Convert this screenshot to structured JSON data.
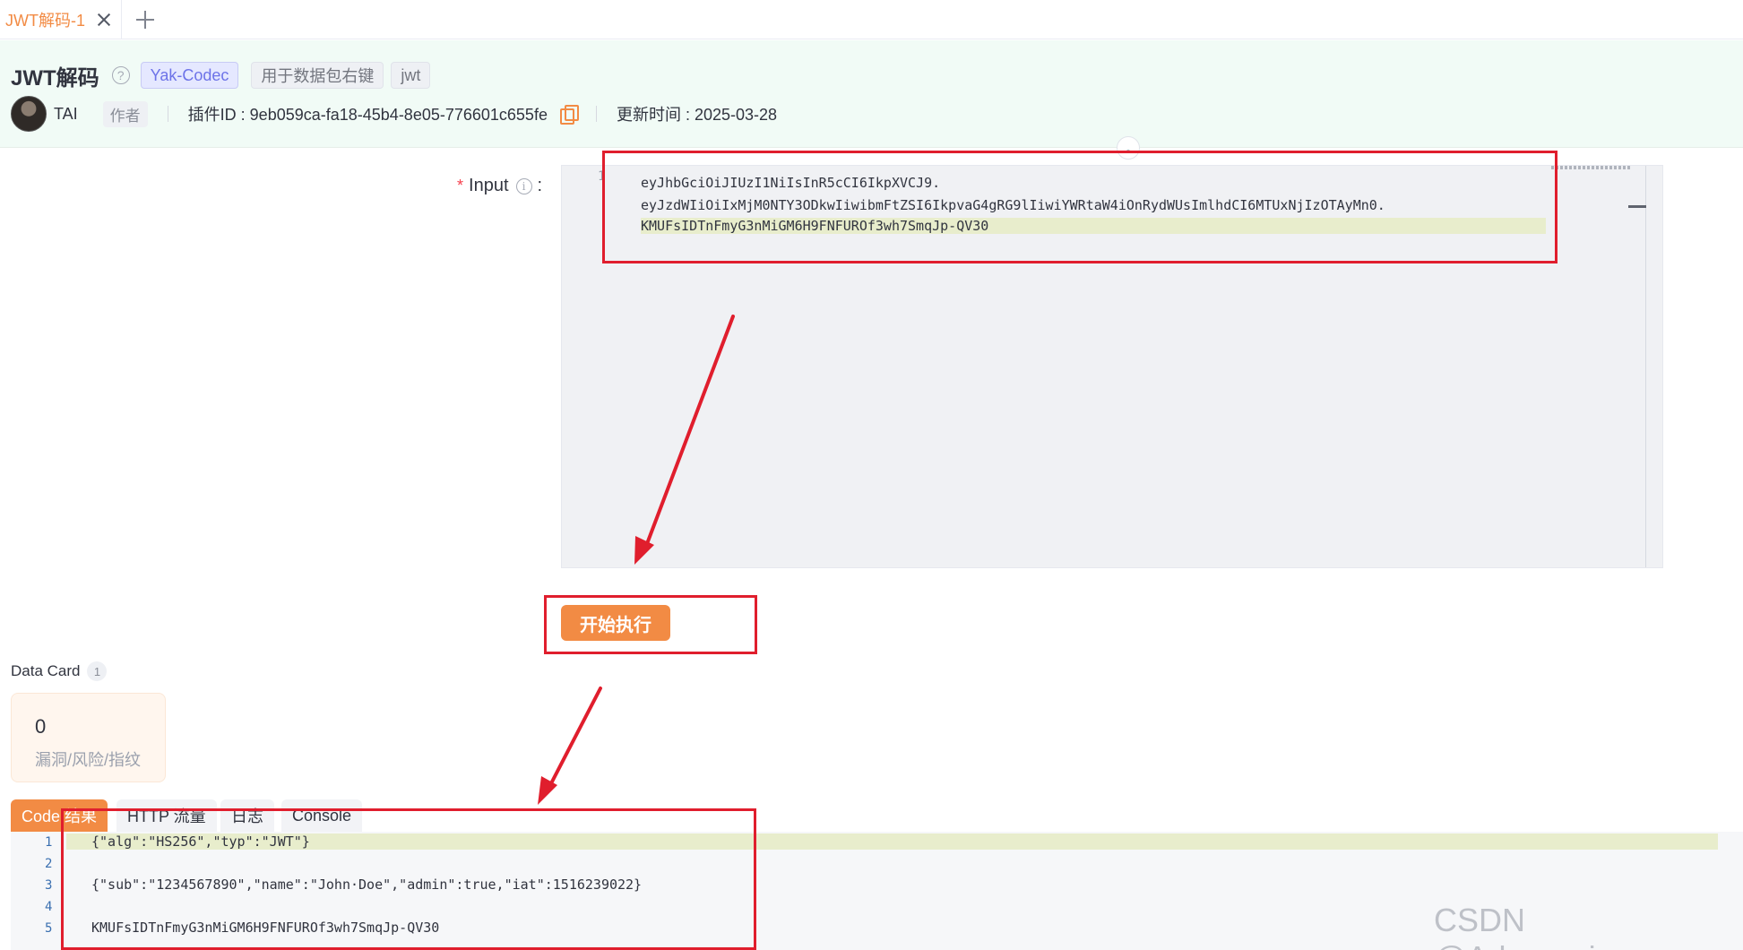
{
  "tabs": {
    "active_label": "JWT解码-1"
  },
  "header": {
    "title": "JWT解码",
    "tags": [
      "Yak-Codec",
      "用于数据包右键",
      "jwt"
    ],
    "author": {
      "name": "TAI",
      "role": "作者"
    },
    "plugin_id": "插件ID : 9eb059ca-fa18-45b4-8e05-776601c655fe",
    "updated": "更新时间 : 2025-03-28"
  },
  "input": {
    "label": "Input",
    "required_mark": "*",
    "colon": ":",
    "line_number": "1",
    "lines": [
      "eyJhbGciOiJIUzI1NiIsInR5cCI6IkpXVCJ9.",
      "eyJzdWIiOiIxMjM0NTY3ODkwIiwibmFtZSI6IkpvaG4gRG9lIiwiYWRtaW4iOnRydWUsImlhdCI6MTUxNjIzOTAyMn0.",
      "KMUFsIDTnFmyG3nMiGM6H9FNFUROf3wh7SmqJp-QV30"
    ]
  },
  "actions": {
    "execute_label": "开始执行"
  },
  "data_card": {
    "title": "Data Card",
    "count": "1",
    "value": "0",
    "label": "漏洞/风险/指纹"
  },
  "result_tabs": [
    "Code 结果",
    "HTTP 流量",
    "日志",
    "Console"
  ],
  "output": {
    "line_numbers": [
      "1",
      "2",
      "3",
      "4",
      "5"
    ],
    "lines": [
      "{\"alg\":\"HS256\",\"typ\":\"JWT\"}",
      "",
      "{\"sub\":\"1234567890\",\"name\":\"John·Doe\",\"admin\":true,\"iat\":1516239022}",
      "",
      "KMUFsIDTnFmyG3nMiGM6H9FNFUROf3wh7SmqJp-QV30"
    ]
  },
  "watermark": "CSDN @Arkmornings",
  "colors": {
    "accent": "#f28b44",
    "header_bg": "#f1fbf6",
    "annotation_red": "#e01e2d"
  }
}
